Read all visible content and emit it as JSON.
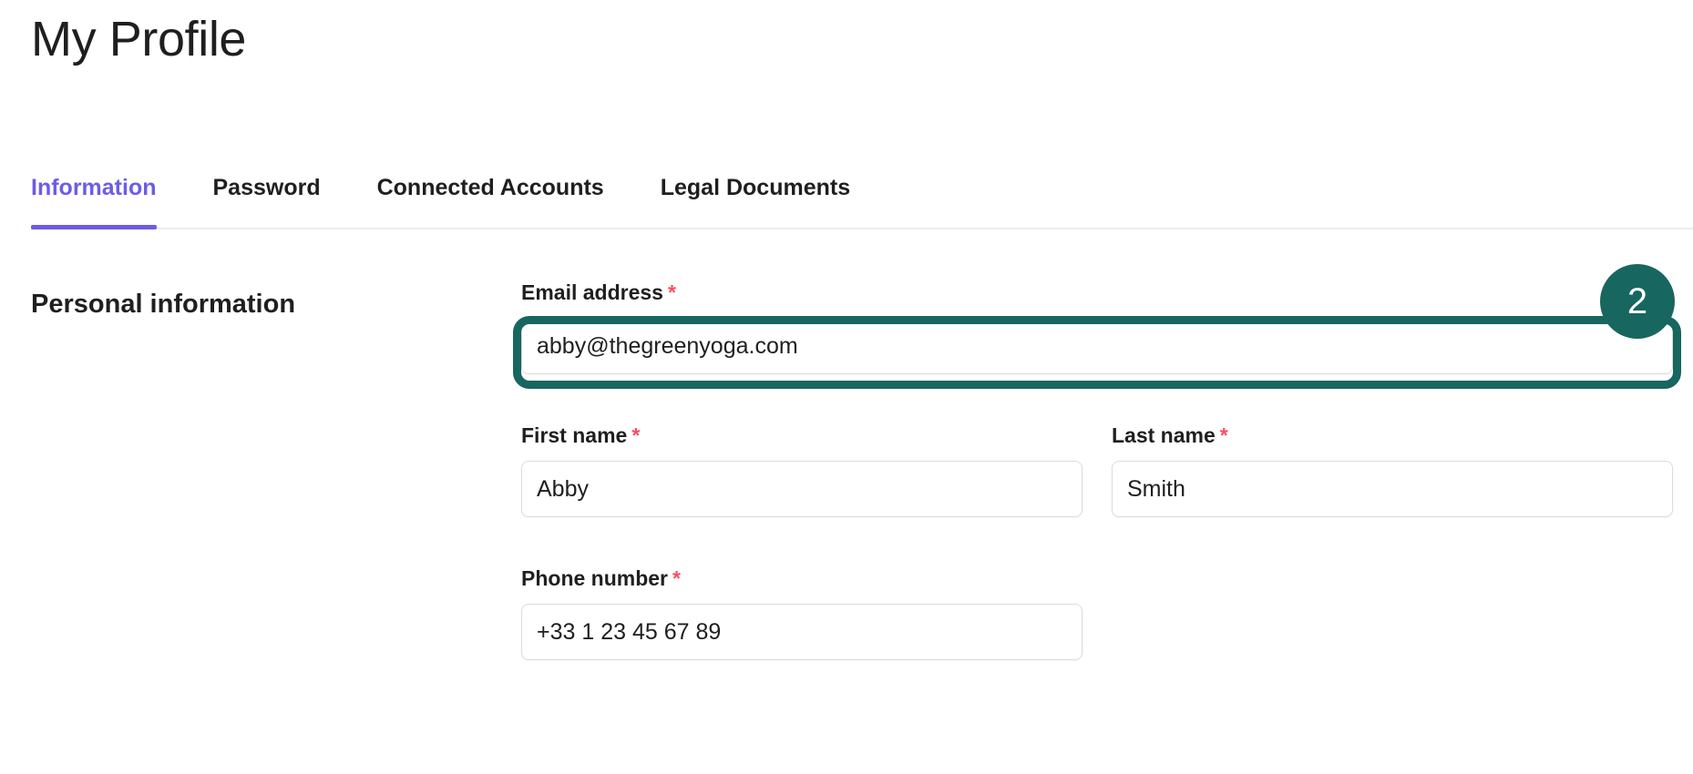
{
  "page": {
    "title": "My Profile"
  },
  "tabs": [
    {
      "id": "information",
      "label": "Information",
      "active": true
    },
    {
      "id": "password",
      "label": "Password",
      "active": false
    },
    {
      "id": "connected-accounts",
      "label": "Connected Accounts",
      "active": false
    },
    {
      "id": "legal-documents",
      "label": "Legal Documents",
      "active": false
    }
  ],
  "section": {
    "heading": "Personal information"
  },
  "form": {
    "required_marker": "*",
    "email": {
      "label": "Email address",
      "value": "abby@thegreenyoga.com",
      "placeholder": "Email address",
      "required": true,
      "highlighted": true
    },
    "first_name": {
      "label": "First name",
      "value": "Abby",
      "placeholder": "First name",
      "required": true
    },
    "last_name": {
      "label": "Last name",
      "value": "Smith",
      "placeholder": "Last name",
      "required": true
    },
    "phone": {
      "label": "Phone number",
      "value": "+33 1 23 45 67 89",
      "placeholder": "Phone number",
      "required": true
    }
  },
  "annotation": {
    "step_badge_number": "2"
  },
  "colors": {
    "accent_purple": "#6c5ce7",
    "highlight_teal": "#17665f",
    "required_red": "#fa4d5e",
    "text_primary": "#1f1f1f",
    "border_gray": "#dcdcdc"
  }
}
